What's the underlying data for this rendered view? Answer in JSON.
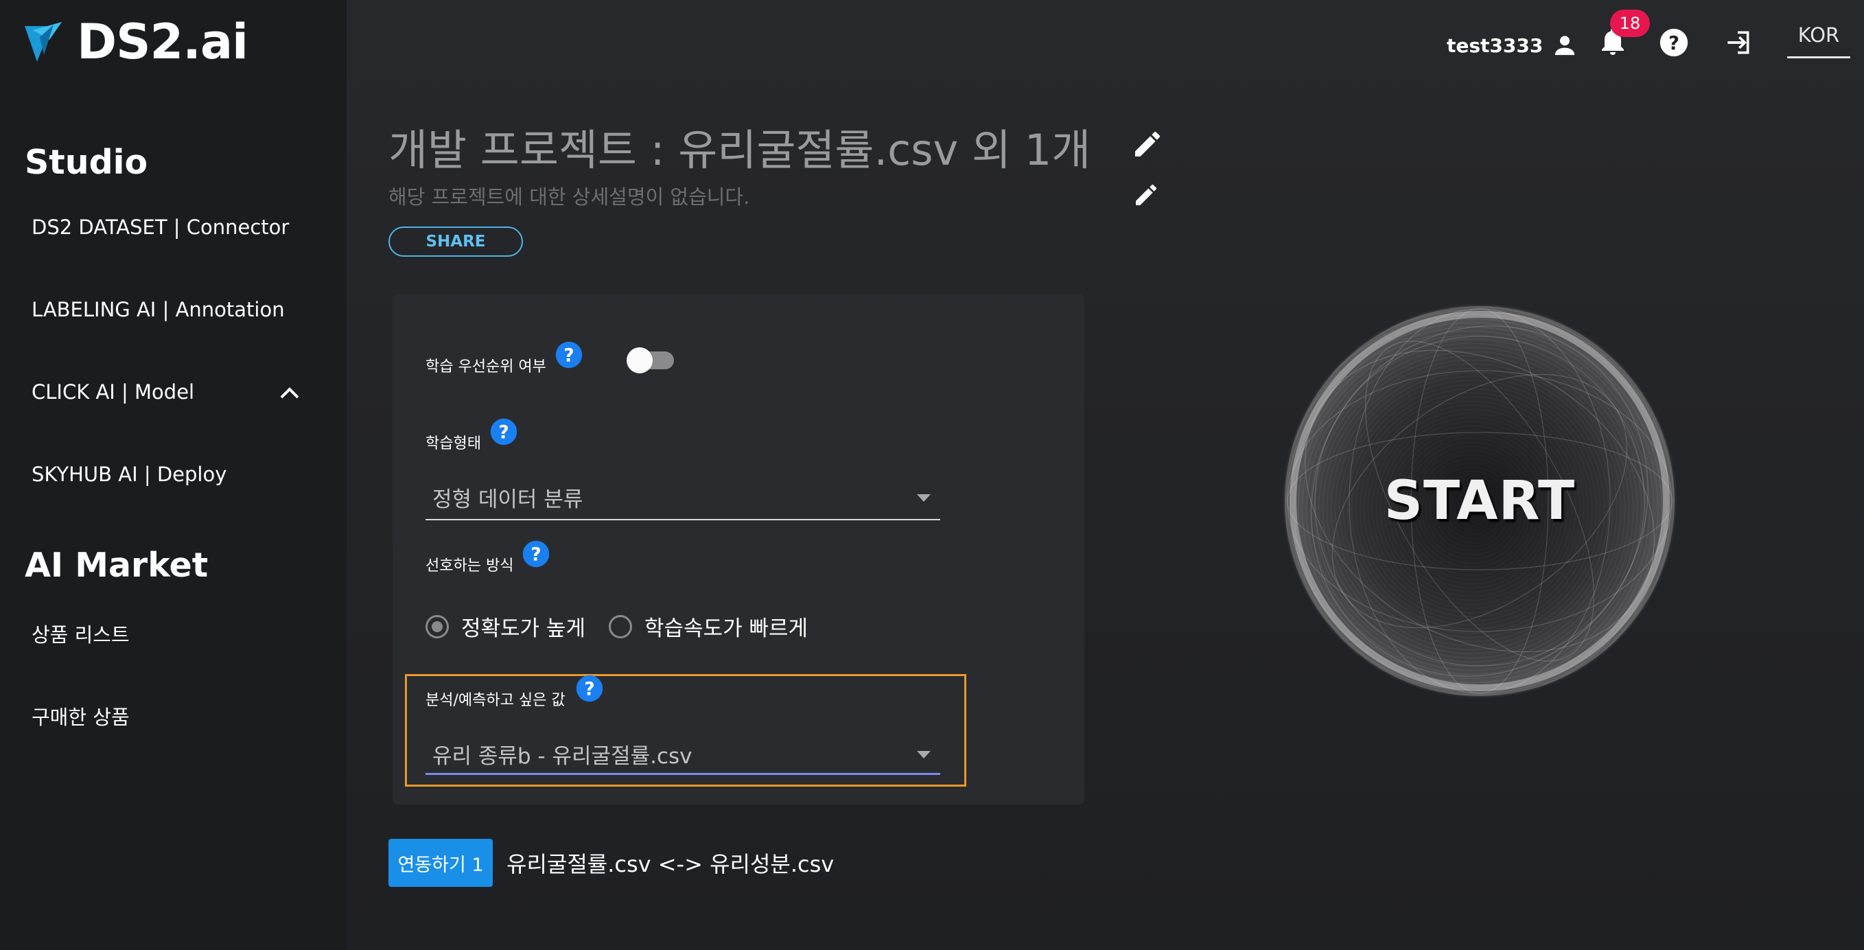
{
  "brand": {
    "name": "DS2.ai"
  },
  "sidebar": {
    "sections": [
      {
        "title": "Studio"
      },
      {
        "title": "AI Market"
      }
    ],
    "items": [
      {
        "label": "DS2 DATASET | Connector"
      },
      {
        "label": "LABELING AI | Annotation"
      },
      {
        "label": "CLICK AI | Model"
      },
      {
        "label": "SKYHUB AI | Deploy"
      },
      {
        "label": "상품 리스트"
      },
      {
        "label": "구매한 상품"
      }
    ]
  },
  "header": {
    "username": "test3333",
    "notification_count": "18",
    "language": "KOR"
  },
  "project": {
    "title": "개발 프로젝트 : 유리굴절률.csv 외 1개",
    "description": "해당 프로젝트에 대한 상세설명이 없습니다.",
    "share_label": "SHARE"
  },
  "form": {
    "priority_label": "학습 우선순위 여부",
    "priority_enabled": false,
    "training_type_label": "학습형태",
    "training_type_value": "정형 데이터 분류",
    "preference_label": "선호하는 방식",
    "preference_options": [
      {
        "label": "정확도가 높게",
        "selected": true
      },
      {
        "label": "학습속도가 빠르게",
        "selected": false
      }
    ],
    "target_label": "분석/예측하고 싶은 값",
    "target_value": "유리 종류b - 유리굴절률.csv"
  },
  "linkage": {
    "button_label": "연동하기 1",
    "text": "유리굴절률.csv <-> 유리성분.csv"
  },
  "start_label": "START",
  "colors": {
    "accent_blue": "#1a8fe8",
    "share_border": "#4eb3e8",
    "highlight_border": "#e59a2a",
    "badge": "#e8164f"
  }
}
